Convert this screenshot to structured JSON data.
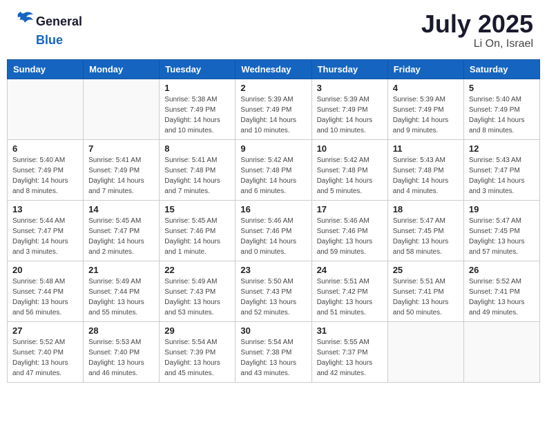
{
  "header": {
    "logo_general": "General",
    "logo_blue": "Blue",
    "title": "July 2025",
    "subtitle": "Li On, Israel"
  },
  "calendar": {
    "days_of_week": [
      "Sunday",
      "Monday",
      "Tuesday",
      "Wednesday",
      "Thursday",
      "Friday",
      "Saturday"
    ],
    "weeks": [
      [
        {
          "day": "",
          "info": ""
        },
        {
          "day": "",
          "info": ""
        },
        {
          "day": "1",
          "info": "Sunrise: 5:38 AM\nSunset: 7:49 PM\nDaylight: 14 hours\nand 10 minutes."
        },
        {
          "day": "2",
          "info": "Sunrise: 5:39 AM\nSunset: 7:49 PM\nDaylight: 14 hours\nand 10 minutes."
        },
        {
          "day": "3",
          "info": "Sunrise: 5:39 AM\nSunset: 7:49 PM\nDaylight: 14 hours\nand 10 minutes."
        },
        {
          "day": "4",
          "info": "Sunrise: 5:39 AM\nSunset: 7:49 PM\nDaylight: 14 hours\nand 9 minutes."
        },
        {
          "day": "5",
          "info": "Sunrise: 5:40 AM\nSunset: 7:49 PM\nDaylight: 14 hours\nand 8 minutes."
        }
      ],
      [
        {
          "day": "6",
          "info": "Sunrise: 5:40 AM\nSunset: 7:49 PM\nDaylight: 14 hours\nand 8 minutes."
        },
        {
          "day": "7",
          "info": "Sunrise: 5:41 AM\nSunset: 7:49 PM\nDaylight: 14 hours\nand 7 minutes."
        },
        {
          "day": "8",
          "info": "Sunrise: 5:41 AM\nSunset: 7:48 PM\nDaylight: 14 hours\nand 7 minutes."
        },
        {
          "day": "9",
          "info": "Sunrise: 5:42 AM\nSunset: 7:48 PM\nDaylight: 14 hours\nand 6 minutes."
        },
        {
          "day": "10",
          "info": "Sunrise: 5:42 AM\nSunset: 7:48 PM\nDaylight: 14 hours\nand 5 minutes."
        },
        {
          "day": "11",
          "info": "Sunrise: 5:43 AM\nSunset: 7:48 PM\nDaylight: 14 hours\nand 4 minutes."
        },
        {
          "day": "12",
          "info": "Sunrise: 5:43 AM\nSunset: 7:47 PM\nDaylight: 14 hours\nand 3 minutes."
        }
      ],
      [
        {
          "day": "13",
          "info": "Sunrise: 5:44 AM\nSunset: 7:47 PM\nDaylight: 14 hours\nand 3 minutes."
        },
        {
          "day": "14",
          "info": "Sunrise: 5:45 AM\nSunset: 7:47 PM\nDaylight: 14 hours\nand 2 minutes."
        },
        {
          "day": "15",
          "info": "Sunrise: 5:45 AM\nSunset: 7:46 PM\nDaylight: 14 hours\nand 1 minute."
        },
        {
          "day": "16",
          "info": "Sunrise: 5:46 AM\nSunset: 7:46 PM\nDaylight: 14 hours\nand 0 minutes."
        },
        {
          "day": "17",
          "info": "Sunrise: 5:46 AM\nSunset: 7:46 PM\nDaylight: 13 hours\nand 59 minutes."
        },
        {
          "day": "18",
          "info": "Sunrise: 5:47 AM\nSunset: 7:45 PM\nDaylight: 13 hours\nand 58 minutes."
        },
        {
          "day": "19",
          "info": "Sunrise: 5:47 AM\nSunset: 7:45 PM\nDaylight: 13 hours\nand 57 minutes."
        }
      ],
      [
        {
          "day": "20",
          "info": "Sunrise: 5:48 AM\nSunset: 7:44 PM\nDaylight: 13 hours\nand 56 minutes."
        },
        {
          "day": "21",
          "info": "Sunrise: 5:49 AM\nSunset: 7:44 PM\nDaylight: 13 hours\nand 55 minutes."
        },
        {
          "day": "22",
          "info": "Sunrise: 5:49 AM\nSunset: 7:43 PM\nDaylight: 13 hours\nand 53 minutes."
        },
        {
          "day": "23",
          "info": "Sunrise: 5:50 AM\nSunset: 7:43 PM\nDaylight: 13 hours\nand 52 minutes."
        },
        {
          "day": "24",
          "info": "Sunrise: 5:51 AM\nSunset: 7:42 PM\nDaylight: 13 hours\nand 51 minutes."
        },
        {
          "day": "25",
          "info": "Sunrise: 5:51 AM\nSunset: 7:41 PM\nDaylight: 13 hours\nand 50 minutes."
        },
        {
          "day": "26",
          "info": "Sunrise: 5:52 AM\nSunset: 7:41 PM\nDaylight: 13 hours\nand 49 minutes."
        }
      ],
      [
        {
          "day": "27",
          "info": "Sunrise: 5:52 AM\nSunset: 7:40 PM\nDaylight: 13 hours\nand 47 minutes."
        },
        {
          "day": "28",
          "info": "Sunrise: 5:53 AM\nSunset: 7:40 PM\nDaylight: 13 hours\nand 46 minutes."
        },
        {
          "day": "29",
          "info": "Sunrise: 5:54 AM\nSunset: 7:39 PM\nDaylight: 13 hours\nand 45 minutes."
        },
        {
          "day": "30",
          "info": "Sunrise: 5:54 AM\nSunset: 7:38 PM\nDaylight: 13 hours\nand 43 minutes."
        },
        {
          "day": "31",
          "info": "Sunrise: 5:55 AM\nSunset: 7:37 PM\nDaylight: 13 hours\nand 42 minutes."
        },
        {
          "day": "",
          "info": ""
        },
        {
          "day": "",
          "info": ""
        }
      ]
    ]
  }
}
